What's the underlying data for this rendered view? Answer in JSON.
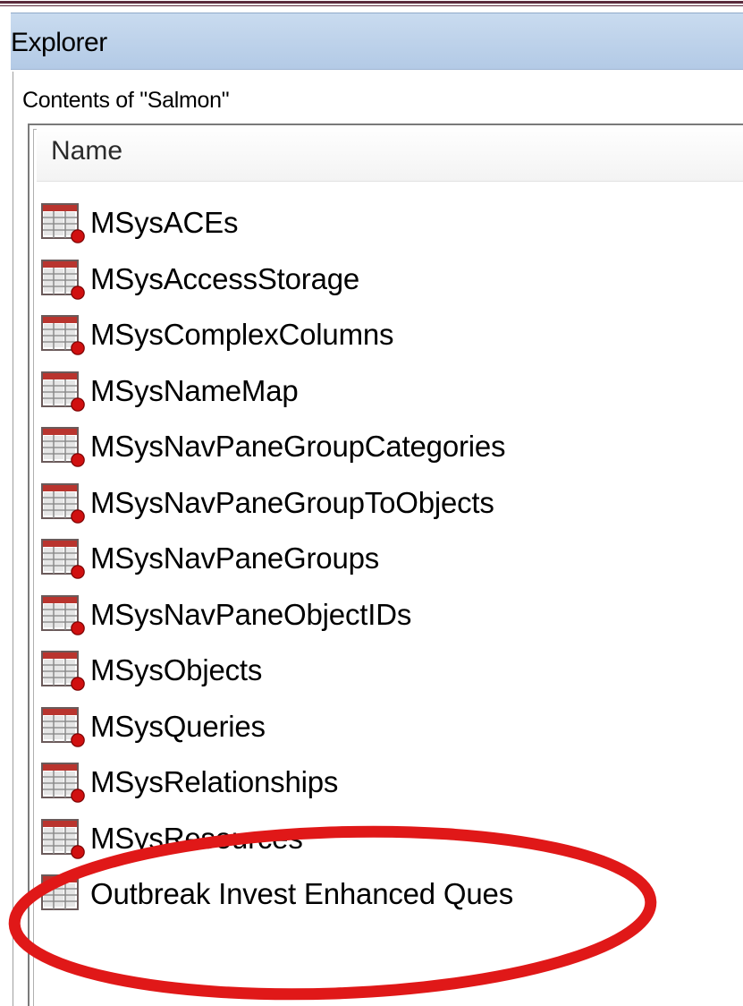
{
  "window": {
    "title": "Explorer"
  },
  "panel": {
    "contents_label": "Contents of \"Salmon\""
  },
  "list": {
    "column_header": "Name",
    "items": [
      {
        "label": "MSysACEs",
        "icon": "system-table-icon"
      },
      {
        "label": "MSysAccessStorage",
        "icon": "system-table-icon"
      },
      {
        "label": "MSysComplexColumns",
        "icon": "system-table-icon"
      },
      {
        "label": "MSysNameMap",
        "icon": "system-table-icon"
      },
      {
        "label": "MSysNavPaneGroupCategories",
        "icon": "system-table-icon"
      },
      {
        "label": "MSysNavPaneGroupToObjects",
        "icon": "system-table-icon"
      },
      {
        "label": "MSysNavPaneGroups",
        "icon": "system-table-icon"
      },
      {
        "label": "MSysNavPaneObjectIDs",
        "icon": "system-table-icon"
      },
      {
        "label": "MSysObjects",
        "icon": "system-table-icon"
      },
      {
        "label": "MSysQueries",
        "icon": "system-table-icon"
      },
      {
        "label": "MSysRelationships",
        "icon": "system-table-icon"
      },
      {
        "label": "MSysResources",
        "icon": "system-table-icon"
      },
      {
        "label": "Outbreak Invest Enhanced Ques",
        "icon": "table-icon"
      }
    ]
  },
  "annotation": {
    "color": "#e01818",
    "highlighted_item": "Outbreak Invest Enhanced Ques"
  }
}
